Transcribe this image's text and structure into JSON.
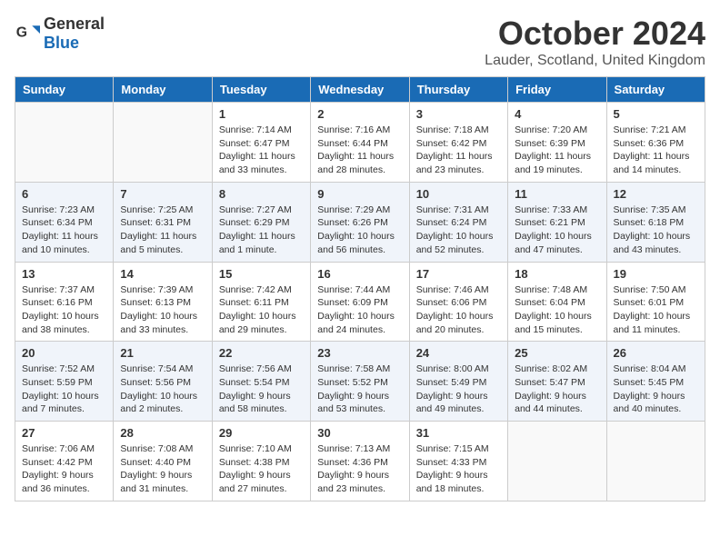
{
  "logo": {
    "text_general": "General",
    "text_blue": "Blue"
  },
  "title": "October 2024",
  "location": "Lauder, Scotland, United Kingdom",
  "days_of_week": [
    "Sunday",
    "Monday",
    "Tuesday",
    "Wednesday",
    "Thursday",
    "Friday",
    "Saturday"
  ],
  "weeks": [
    [
      {
        "day": "",
        "info": ""
      },
      {
        "day": "",
        "info": ""
      },
      {
        "day": "1",
        "info": "Sunrise: 7:14 AM\nSunset: 6:47 PM\nDaylight: 11 hours and 33 minutes."
      },
      {
        "day": "2",
        "info": "Sunrise: 7:16 AM\nSunset: 6:44 PM\nDaylight: 11 hours and 28 minutes."
      },
      {
        "day": "3",
        "info": "Sunrise: 7:18 AM\nSunset: 6:42 PM\nDaylight: 11 hours and 23 minutes."
      },
      {
        "day": "4",
        "info": "Sunrise: 7:20 AM\nSunset: 6:39 PM\nDaylight: 11 hours and 19 minutes."
      },
      {
        "day": "5",
        "info": "Sunrise: 7:21 AM\nSunset: 6:36 PM\nDaylight: 11 hours and 14 minutes."
      }
    ],
    [
      {
        "day": "6",
        "info": "Sunrise: 7:23 AM\nSunset: 6:34 PM\nDaylight: 11 hours and 10 minutes."
      },
      {
        "day": "7",
        "info": "Sunrise: 7:25 AM\nSunset: 6:31 PM\nDaylight: 11 hours and 5 minutes."
      },
      {
        "day": "8",
        "info": "Sunrise: 7:27 AM\nSunset: 6:29 PM\nDaylight: 11 hours and 1 minute."
      },
      {
        "day": "9",
        "info": "Sunrise: 7:29 AM\nSunset: 6:26 PM\nDaylight: 10 hours and 56 minutes."
      },
      {
        "day": "10",
        "info": "Sunrise: 7:31 AM\nSunset: 6:24 PM\nDaylight: 10 hours and 52 minutes."
      },
      {
        "day": "11",
        "info": "Sunrise: 7:33 AM\nSunset: 6:21 PM\nDaylight: 10 hours and 47 minutes."
      },
      {
        "day": "12",
        "info": "Sunrise: 7:35 AM\nSunset: 6:18 PM\nDaylight: 10 hours and 43 minutes."
      }
    ],
    [
      {
        "day": "13",
        "info": "Sunrise: 7:37 AM\nSunset: 6:16 PM\nDaylight: 10 hours and 38 minutes."
      },
      {
        "day": "14",
        "info": "Sunrise: 7:39 AM\nSunset: 6:13 PM\nDaylight: 10 hours and 33 minutes."
      },
      {
        "day": "15",
        "info": "Sunrise: 7:42 AM\nSunset: 6:11 PM\nDaylight: 10 hours and 29 minutes."
      },
      {
        "day": "16",
        "info": "Sunrise: 7:44 AM\nSunset: 6:09 PM\nDaylight: 10 hours and 24 minutes."
      },
      {
        "day": "17",
        "info": "Sunrise: 7:46 AM\nSunset: 6:06 PM\nDaylight: 10 hours and 20 minutes."
      },
      {
        "day": "18",
        "info": "Sunrise: 7:48 AM\nSunset: 6:04 PM\nDaylight: 10 hours and 15 minutes."
      },
      {
        "day": "19",
        "info": "Sunrise: 7:50 AM\nSunset: 6:01 PM\nDaylight: 10 hours and 11 minutes."
      }
    ],
    [
      {
        "day": "20",
        "info": "Sunrise: 7:52 AM\nSunset: 5:59 PM\nDaylight: 10 hours and 7 minutes."
      },
      {
        "day": "21",
        "info": "Sunrise: 7:54 AM\nSunset: 5:56 PM\nDaylight: 10 hours and 2 minutes."
      },
      {
        "day": "22",
        "info": "Sunrise: 7:56 AM\nSunset: 5:54 PM\nDaylight: 9 hours and 58 minutes."
      },
      {
        "day": "23",
        "info": "Sunrise: 7:58 AM\nSunset: 5:52 PM\nDaylight: 9 hours and 53 minutes."
      },
      {
        "day": "24",
        "info": "Sunrise: 8:00 AM\nSunset: 5:49 PM\nDaylight: 9 hours and 49 minutes."
      },
      {
        "day": "25",
        "info": "Sunrise: 8:02 AM\nSunset: 5:47 PM\nDaylight: 9 hours and 44 minutes."
      },
      {
        "day": "26",
        "info": "Sunrise: 8:04 AM\nSunset: 5:45 PM\nDaylight: 9 hours and 40 minutes."
      }
    ],
    [
      {
        "day": "27",
        "info": "Sunrise: 7:06 AM\nSunset: 4:42 PM\nDaylight: 9 hours and 36 minutes."
      },
      {
        "day": "28",
        "info": "Sunrise: 7:08 AM\nSunset: 4:40 PM\nDaylight: 9 hours and 31 minutes."
      },
      {
        "day": "29",
        "info": "Sunrise: 7:10 AM\nSunset: 4:38 PM\nDaylight: 9 hours and 27 minutes."
      },
      {
        "day": "30",
        "info": "Sunrise: 7:13 AM\nSunset: 4:36 PM\nDaylight: 9 hours and 23 minutes."
      },
      {
        "day": "31",
        "info": "Sunrise: 7:15 AM\nSunset: 4:33 PM\nDaylight: 9 hours and 18 minutes."
      },
      {
        "day": "",
        "info": ""
      },
      {
        "day": "",
        "info": ""
      }
    ]
  ]
}
